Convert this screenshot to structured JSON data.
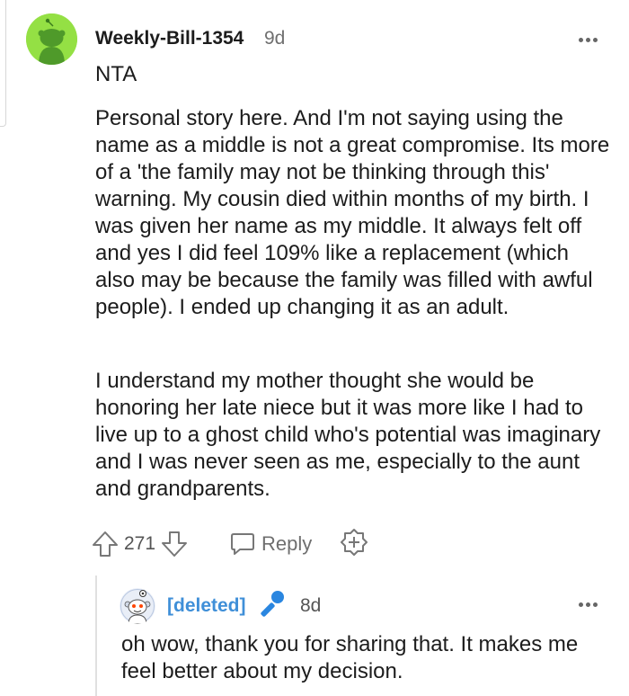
{
  "comment": {
    "username": "Weekly-Bill-1354",
    "time": "9d",
    "text_nta": "NTA",
    "paragraph1": "Personal story here. And I'm not saying using the name as a middle is not a great compromise. Its more of a 'the family may not be thinking through this' warning. My cousin died within months of my birth. I was given her name as my middle. It always felt off and yes I did feel 109% like a replacement (which also may be because the family was filled with awful people). I ended up changing it as an adult.",
    "paragraph2": "I understand my mother thought she would be honoring her late niece but it was more like I had to live up to a ghost child who's potential was imaginary and I was never seen as me, especially to the aunt and grandparents.",
    "vote_count": "271",
    "reply_label": "Reply",
    "avatar_color": "#94e044"
  },
  "reply": {
    "username": "[deleted]",
    "time": "8d",
    "text": "oh wow, thank you for sharing that. It makes me feel better about my decision.",
    "username_color": "#3f8fd8"
  },
  "icons": {
    "more": "more-options-icon",
    "upvote": "upvote-arrow-icon",
    "downvote": "downvote-arrow-icon",
    "reply": "speech-bubble-icon",
    "award": "award-plus-icon",
    "mic": "microphone-icon"
  }
}
